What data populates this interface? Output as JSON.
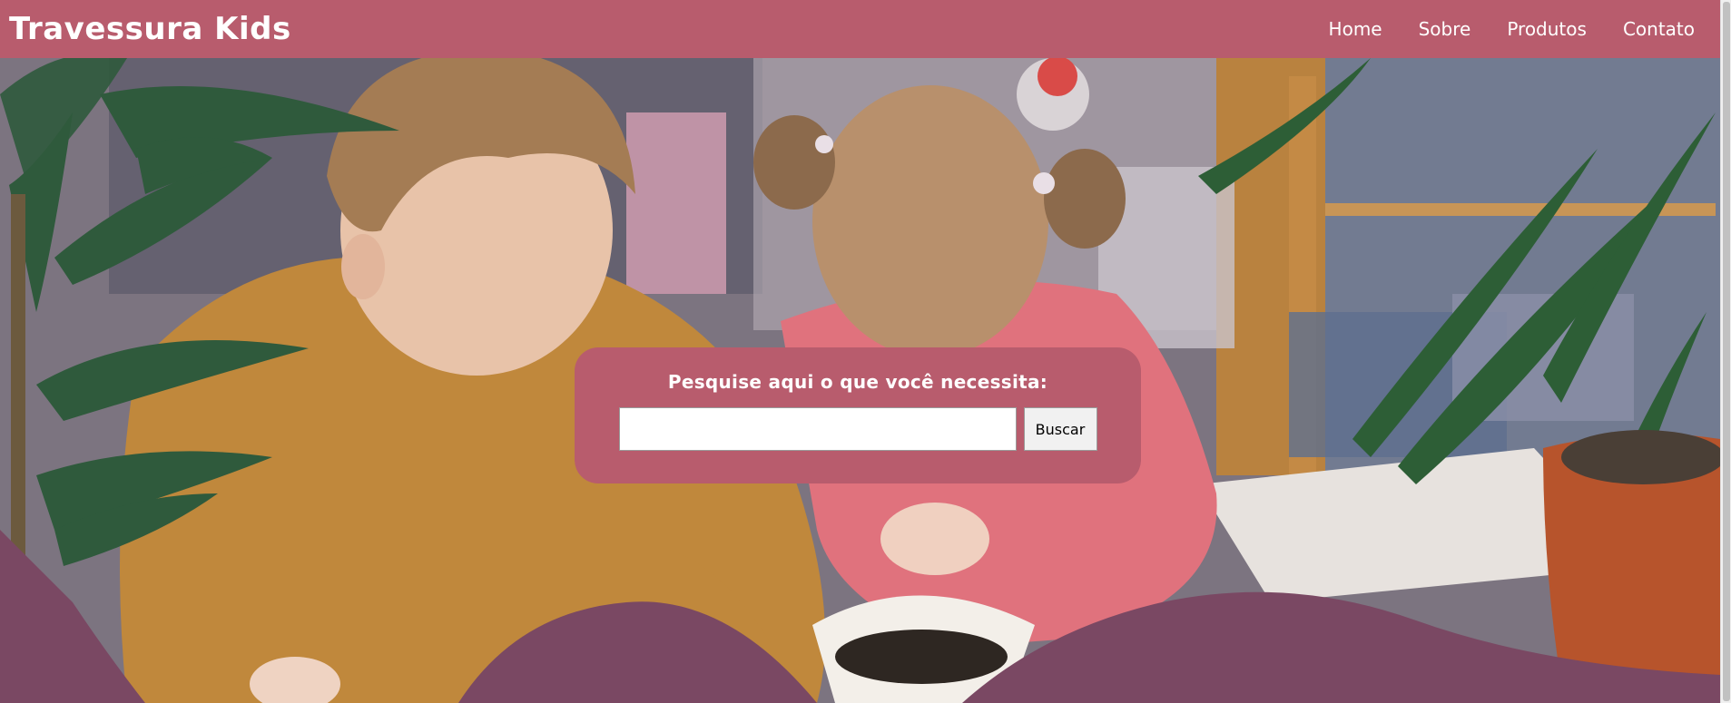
{
  "header": {
    "brand": "Travessura Kids",
    "nav": [
      "Home",
      "Sobre",
      "Produtos",
      "Contato"
    ]
  },
  "search": {
    "title": "Pesquise aqui o que você necessita:",
    "input_value": "",
    "button_label": "Buscar"
  },
  "colors": {
    "brand": "#b85c6d",
    "wave": "#7a4863"
  }
}
